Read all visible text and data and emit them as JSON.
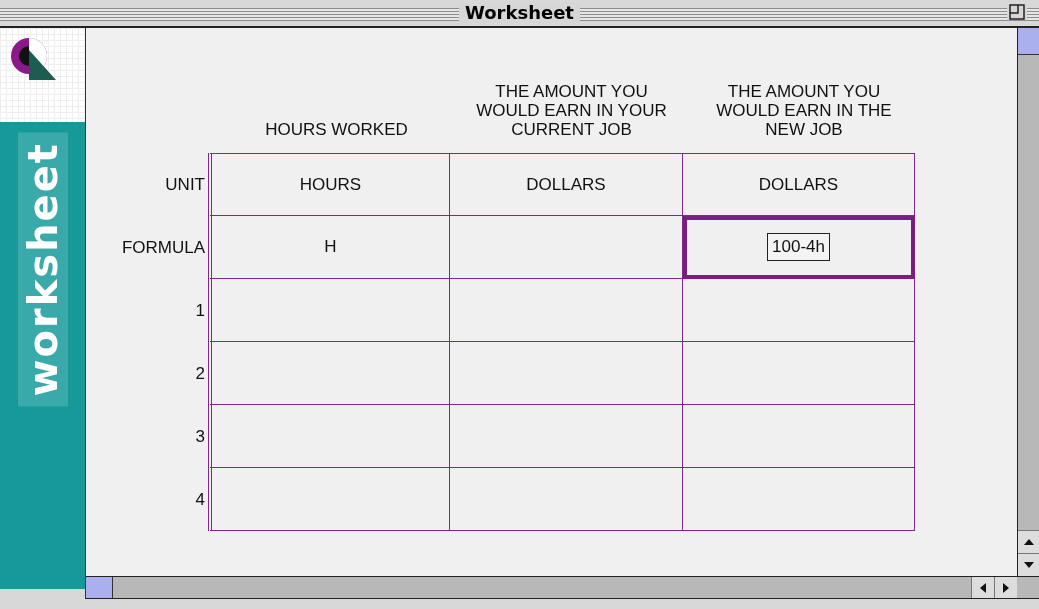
{
  "window": {
    "title": "Worksheet"
  },
  "sidebar": {
    "label": "worksheet"
  },
  "row_headers": {
    "unit": "UNIT",
    "formula": "FORMULA"
  },
  "columns": [
    {
      "heading": "HOURS WORKED",
      "unit": "HOURS",
      "formula": "H",
      "selected": false
    },
    {
      "heading": "THE AMOUNT YOU WOULD EARN IN YOUR CURRENT JOB",
      "unit": "DOLLARS",
      "selected": false
    },
    {
      "heading": "THE AMOUNT YOU WOULD EARN IN THE NEW JOB",
      "unit": "DOLLARS",
      "formula": "100-4h",
      "selected": true
    }
  ],
  "rows": [
    {
      "label": "1"
    },
    {
      "label": "2"
    },
    {
      "label": "3"
    },
    {
      "label": "4"
    }
  ]
}
